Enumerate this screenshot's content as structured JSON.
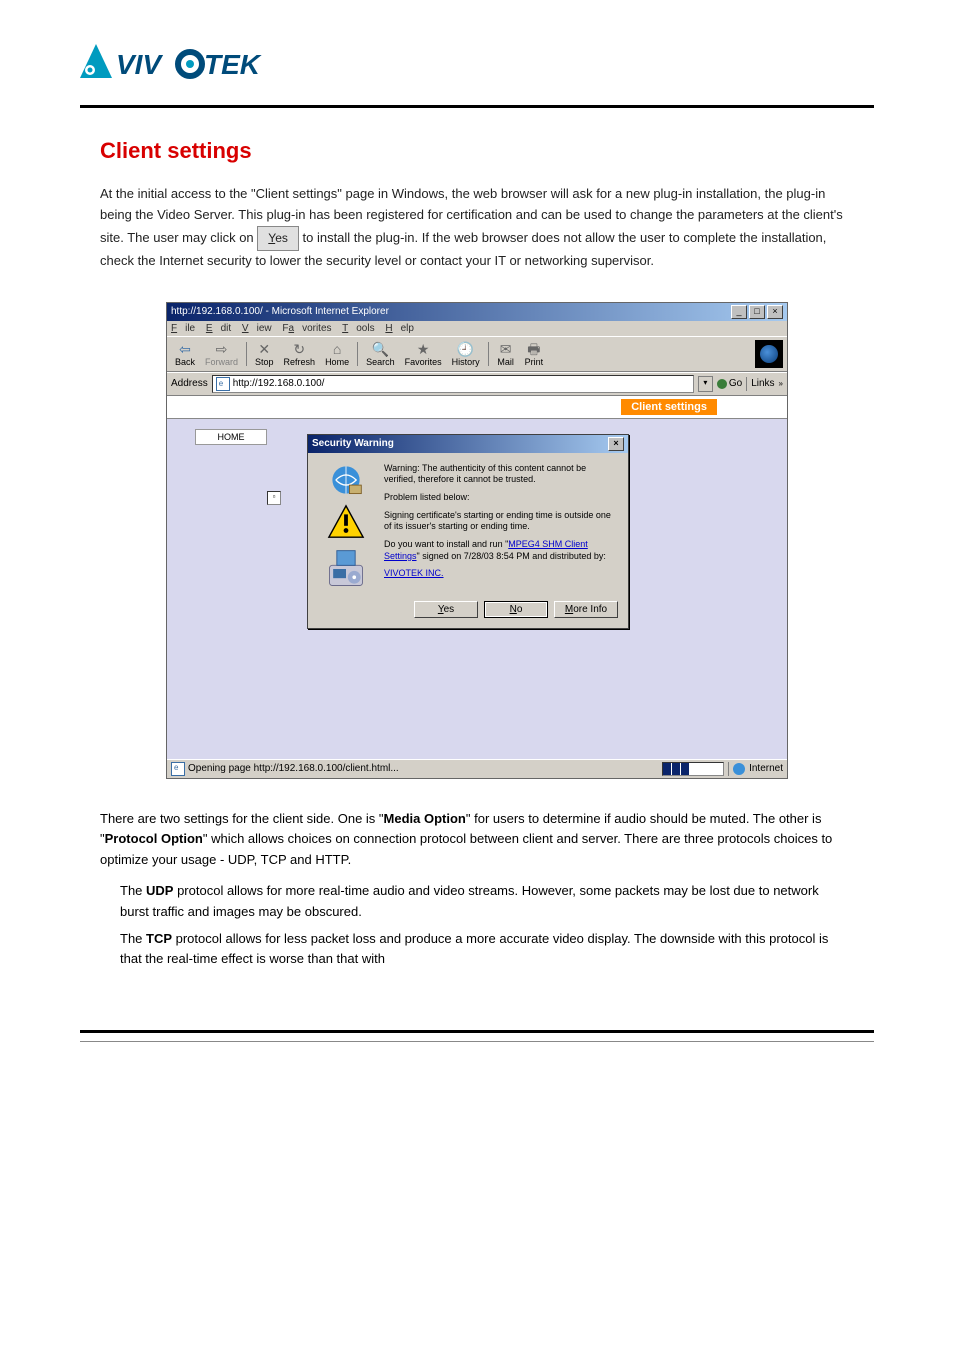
{
  "logo_text": "VIVOTEK",
  "heading": "Client settings",
  "intro_para1": "At the initial access to the \"Client settings\" page in Windows, the web browser will ask for a new plug-in installation, the plug-in being the Video Server. This plug-in has been registered for certification and can be used to change the parameters at the client's site. The user may click on",
  "intro_para2_after_button": " to install the plug-in. If the web browser does not allow the user to complete the installation, check the Internet security to lower the security level or contact your IT or networking supervisor.",
  "yes_button_char": "Y",
  "yes_button_rest": "es",
  "ie": {
    "title": "http://192.168.0.100/ - Microsoft Internet Explorer",
    "menu": {
      "file": "File",
      "edit": "Edit",
      "view": "View",
      "favorites": "Favorites",
      "tools": "Tools",
      "help": "Help"
    },
    "toolbar": {
      "back": "Back",
      "forward": "Forward",
      "stop": "Stop",
      "refresh": "Refresh",
      "home": "Home",
      "search": "Search",
      "fav": "Favorites",
      "history": "History",
      "mail": "Mail",
      "print": "Print"
    },
    "address_label": "Address",
    "address_value": "http://192.168.0.100/",
    "go": "Go",
    "links": "Links",
    "content_top": "Client settings",
    "home": "HOME",
    "status_left": "Opening page http://192.168.0.100/client.html...",
    "status_right": "Internet"
  },
  "dialog": {
    "title": "Security Warning",
    "p1": "Warning: The authenticity of this content cannot be verified, therefore it cannot be trusted.",
    "p2": "Problem listed below:",
    "p3": "Signing certificate's starting or ending time is outside one of its issuer's starting or ending time.",
    "p4a": "Do you want to install and run \"",
    "p4link": "MPEG4 SHM Client Settings",
    "p4b": "\" signed on 7/28/03 8:54 PM and distributed by:",
    "p5link": "VIVOTEK INC.",
    "btn_yes_u": "Y",
    "btn_yes_rest": "es",
    "btn_no_u": "N",
    "btn_no_rest": "o",
    "btn_more_u": "M",
    "btn_more_rest": "ore Info"
  },
  "after_shot_para_a": "There are two settings for the client side. One is \"",
  "media_option": "Media Option",
  "after_shot_para_b": "\" for users to determine if audio should be muted. The other is \"",
  "protocol_option": "Protocol Option",
  "after_shot_para_c": "\" which allows choices on connection protocol between client and server. There are three protocols choices to optimize your usage - UDP, TCP and HTTP.",
  "udp_label": "UDP",
  "udp_text": " protocol allows for more real-time audio and video streams. However, some packets may be lost due to network burst traffic and images may be obscured.",
  "tcp_label": "TCP",
  "tcp_text": " protocol allows for less packet loss and produce a more accurate video display. The downside with this protocol is that the real-time effect is worse than that with"
}
